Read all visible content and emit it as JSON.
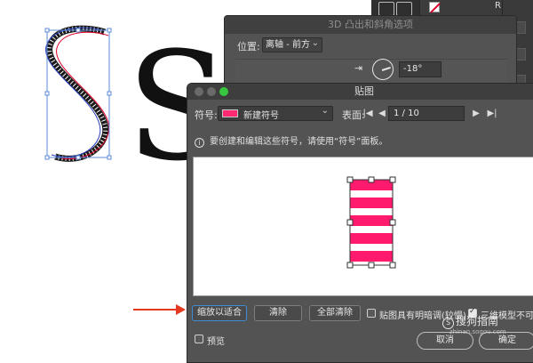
{
  "color_panel": {
    "channel_label": "R"
  },
  "dialog_3d": {
    "title": "3D 凸出和斜角选项",
    "position_label": "位置:",
    "position_value": "离轴 - 前方",
    "rotation_value": "-18°"
  },
  "dialog": {
    "title": "贴图",
    "symbol_label": "符号:",
    "symbol_value": "新建符号",
    "surface_label": "表面:",
    "surface_page": "1 / 10",
    "nav": {
      "first": "|◀",
      "prev": "◀",
      "next": "▶",
      "last": "▶|"
    },
    "info_text": "要创建和编辑这些符号，请使用“符号”面板。",
    "buttons": {
      "scale_to_fit": "缩放以适合",
      "clear": "清除",
      "clear_all": "全部清除",
      "shade_artwork": "贴图具有明暗调(较慢)",
      "invisible_geometry": "三维模型不可见"
    },
    "preview_label": "预览",
    "cancel": "取消",
    "ok": "确定"
  },
  "artwork": {
    "letter": "S"
  },
  "watermark": {
    "brand": "搜狗指南",
    "url": "zhinan.sogou.com"
  },
  "colors": {
    "accent_pink": "#ff1a6e",
    "arrow_red": "#e5381f",
    "dialog_bg": "#535353",
    "title_green": "#37c63f"
  }
}
